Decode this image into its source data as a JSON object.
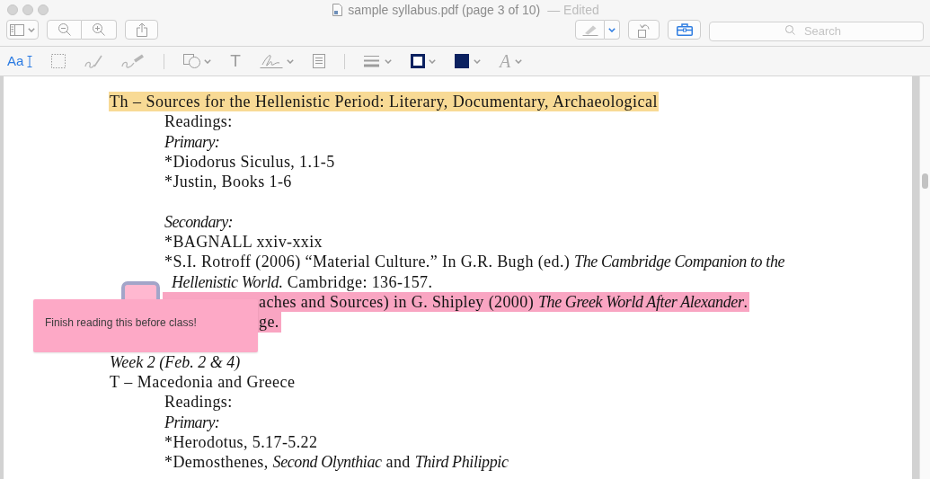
{
  "window": {
    "title": "sample syllabus.pdf (page 3 of 10)",
    "status": "— Edited"
  },
  "toolbar": {
    "left": [
      {
        "kind": "sidebar"
      },
      {
        "kind": "zoom-out"
      },
      {
        "kind": "zoom-in"
      },
      {
        "kind": "share"
      }
    ],
    "right": [
      {
        "kind": "markup",
        "on": false
      },
      {
        "kind": "markup-menu",
        "on": true
      },
      {
        "kind": "rotate",
        "on": false
      },
      {
        "kind": "toolbox",
        "on": true
      }
    ],
    "search": {
      "placeholder": "Search"
    }
  },
  "markup_toolbar": {
    "groups": [
      {
        "tools": [
          {
            "kind": "text-select",
            "label": "Aa",
            "selected": true
          },
          {
            "kind": "rect-select",
            "selected": false
          },
          {
            "kind": "sketch",
            "selected": false
          },
          {
            "kind": "draw",
            "selected": false
          }
        ]
      },
      {
        "tools": [
          {
            "kind": "shapes",
            "selected": false
          },
          {
            "kind": "text",
            "label": "T",
            "selected": false
          },
          {
            "kind": "sign",
            "selected": false
          },
          {
            "kind": "note",
            "selected": false
          }
        ]
      },
      {
        "tools": [
          {
            "kind": "line-style"
          },
          {
            "kind": "border-color",
            "color": "#0b2160"
          },
          {
            "kind": "fill-color",
            "color": "#0b2160"
          },
          {
            "kind": "font",
            "label": "A"
          }
        ]
      }
    ]
  },
  "document": {
    "blocks": [
      {
        "kind": "session",
        "text": "Th – Sources for the Hellenistic Period: Literary, Documentary, Archaeological",
        "color": "#f8da95",
        "children": [
          {
            "kind": "line",
            "text": "Readings:"
          },
          {
            "kind": "label",
            "text": "Primary:"
          },
          {
            "kind": "line",
            "text": "*Diodorus Siculus, 1.1-5"
          },
          {
            "kind": "line",
            "text": "*Justin, Books 1-6"
          },
          {
            "kind": "blank"
          },
          {
            "kind": "label",
            "text": "Secondary:"
          },
          {
            "kind": "line",
            "text": "*BAGNALL xxiv-xxix"
          },
          {
            "kind": "line",
            "parts": [
              {
                "text": "*S.I. Rotroff (2006) “Material Culture.” In G.R. Bugh (ed.) ",
                "italic": false
              },
              {
                "text": "The Cambridge Companion to the",
                "italic": true
              }
            ]
          },
          {
            "kind": "continuation",
            "parts": [
              {
                "text": "Hellenistic World",
                "italic": true
              },
              {
                "text": ". Cambridge: 136-157.",
                "italic": false
              }
            ]
          },
          {
            "kind": "covered",
            "color": "#f9a5c2",
            "parts": [
              {
                "text": "aches and Sources) in G. Shipley (2000) ",
                "italic": false
              },
              {
                "text": "The Greek World After Alexander",
                "italic": true
              },
              {
                "text": ".",
                "italic": false
              }
            ]
          },
          {
            "kind": "covered",
            "color": "#f9a5c2",
            "text": "ge."
          },
          {
            "kind": "blank"
          }
        ]
      },
      {
        "kind": "week",
        "text": "Week 2 (Feb. 2 & 4)"
      },
      {
        "kind": "session",
        "text": "T – Macedonia and Greece",
        "children": [
          {
            "kind": "line",
            "text": "Readings:"
          },
          {
            "kind": "label",
            "text": "Primary:"
          },
          {
            "kind": "line",
            "text": "*Herodotus, 5.17-5.22"
          },
          {
            "kind": "line",
            "parts": [
              {
                "text": "*Demosthenes, ",
                "italic": false
              },
              {
                "text": "Second Olynthiac",
                "italic": true
              },
              {
                "text": " and ",
                "italic": false
              },
              {
                "text": "Third Philippic",
                "italic": true
              }
            ]
          }
        ]
      }
    ],
    "note": {
      "text": "Finish reading this before class!"
    }
  }
}
